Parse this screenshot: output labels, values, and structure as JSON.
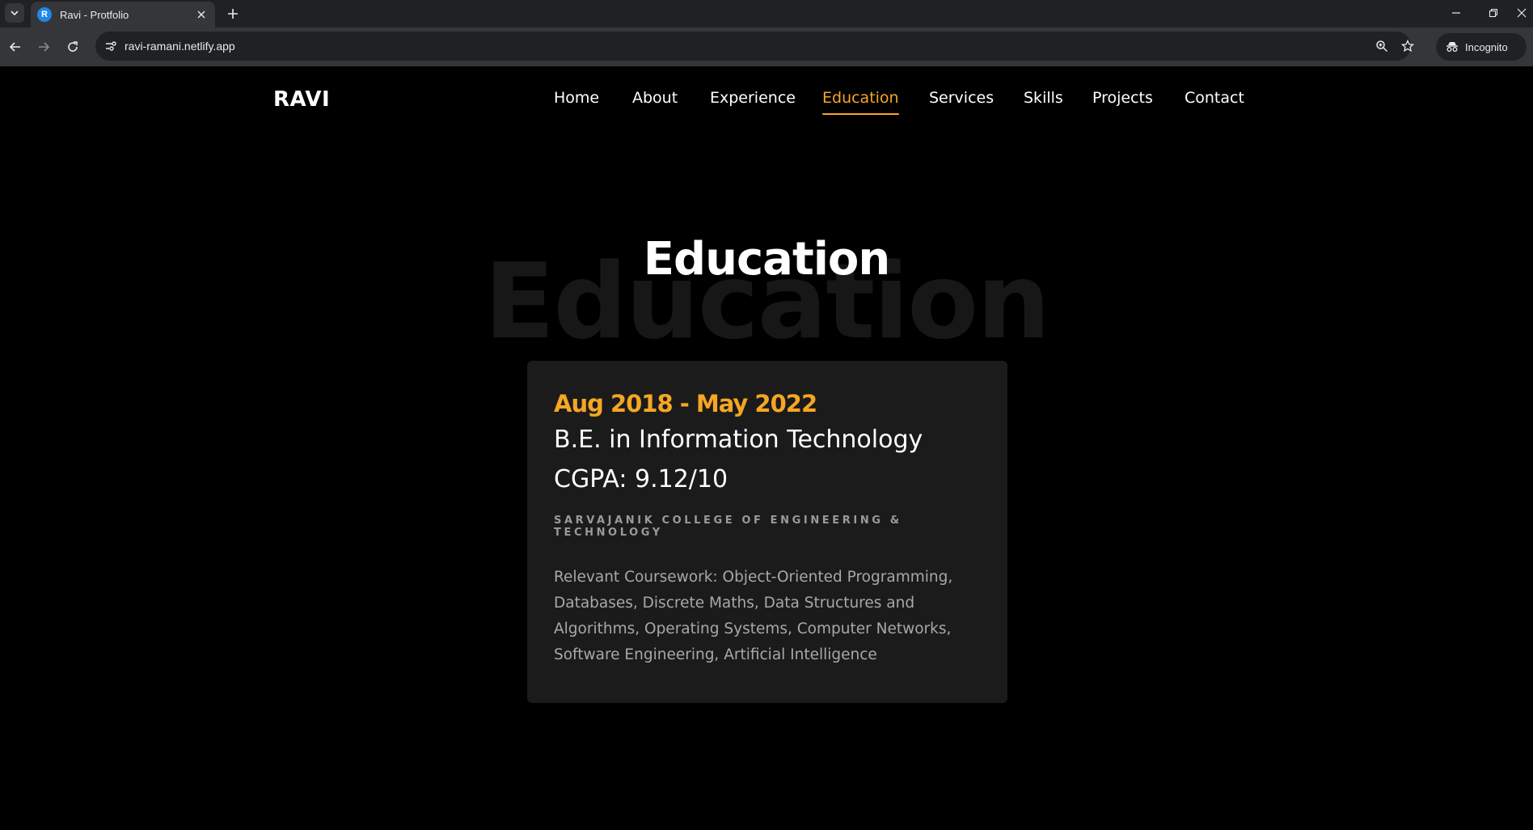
{
  "browser": {
    "tab_title": "Ravi - Protfolio",
    "favicon_letter": "R",
    "url": "ravi-ramani.netlify.app",
    "incognito_label": "Incognito"
  },
  "site": {
    "logo": "RAVI",
    "nav": [
      {
        "label": "Home"
      },
      {
        "label": "About"
      },
      {
        "label": "Experience"
      },
      {
        "label": "Education",
        "active": true
      },
      {
        "label": "Services"
      },
      {
        "label": "Skills"
      },
      {
        "label": "Projects"
      },
      {
        "label": "Contact"
      }
    ],
    "accent_color": "#f5a623"
  },
  "section": {
    "title": "Education",
    "background_title": "Education"
  },
  "education": {
    "date_range": "Aug 2018 - May 2022",
    "degree": "B.E. in Information Technology",
    "cgpa": "CGPA: 9.12/10",
    "college": "SARVAJANIK COLLEGE OF ENGINEERING & TECHNOLOGY",
    "coursework": "Relevant Coursework: Object-Oriented Programming, Databases, Discrete Maths, Data Structures and Algorithms, Operating Systems, Computer Networks, Software Engineering, Artificial Intelligence"
  }
}
